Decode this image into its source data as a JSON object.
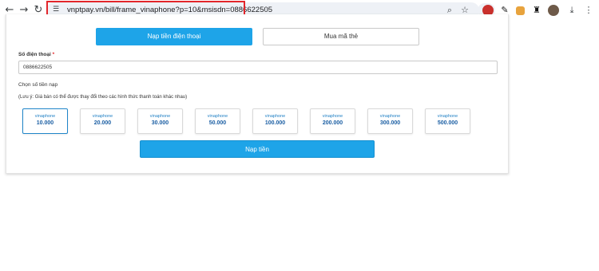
{
  "browser": {
    "url": "vnptpay.vn/bill/frame_vinaphone?p=10&msisdn=0886622505",
    "icons": {
      "back": "arrow-left-icon",
      "forward": "arrow-right-icon",
      "reload": "reload-icon",
      "site_info": "tune-icon",
      "zoom": "zoom-icon",
      "bookmark": "star-icon",
      "download": "download-icon",
      "menu": "more-vert-icon"
    }
  },
  "tabs": {
    "active": "Nạp tiền điện thoại",
    "inactive": "Mua mã thẻ"
  },
  "phone": {
    "label": "Số điện thoại",
    "required_mark": "*",
    "value": "0886622505"
  },
  "amount": {
    "label": "Chọn số tiền nạp",
    "note": "(Lưu ý: Giá bán có thể được thay đổi theo các hình thức thanh toán khác nhau)",
    "options": [
      {
        "brand": "vinaphone",
        "value": "10.000",
        "selected": true
      },
      {
        "brand": "vinaphone",
        "value": "20.000",
        "selected": false
      },
      {
        "brand": "vinaphone",
        "value": "30.000",
        "selected": false
      },
      {
        "brand": "vinaphone",
        "value": "50.000",
        "selected": false
      },
      {
        "brand": "vinaphone",
        "value": "100.000",
        "selected": false
      },
      {
        "brand": "vinaphone",
        "value": "200.000",
        "selected": false
      },
      {
        "brand": "vinaphone",
        "value": "300.000",
        "selected": false
      },
      {
        "brand": "vinaphone",
        "value": "500.000",
        "selected": false
      }
    ]
  },
  "submit_label": "Nạp tiền",
  "colors": {
    "accent": "#1ea4e8",
    "highlight_border": "#e3262b",
    "denom_value": "#1a5ea3"
  }
}
